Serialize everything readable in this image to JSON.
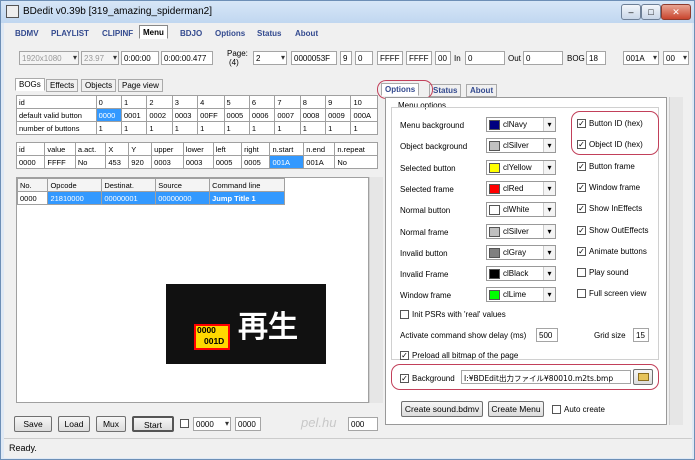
{
  "window": {
    "title": "BDedit v0.39b [319_amazing_spiderman2]",
    "min": "–",
    "max": "□",
    "close": "✕"
  },
  "tabs": [
    "BDMV",
    "PLAYLIST",
    "CLIPINF",
    "Menu",
    "BDJO",
    "Options",
    "Status",
    "About"
  ],
  "toolbar": {
    "resolution": "1920x1080",
    "framerate": "23.97",
    "time_start": "0:00:00",
    "time_end": "0:00:00.477",
    "page_label": "Page:",
    "page_count": "(4)",
    "page_value": "2",
    "page_field": "0000053F",
    "f1": "9",
    "f2": "0",
    "f3": "FFFF",
    "f4": "FFFF",
    "f5": "00",
    "in_label": "In",
    "in_value": "0",
    "out_label": "Out",
    "out_value": "0",
    "bog_label": "BOG",
    "bog_value": "18",
    "sel1": "001A",
    "sel2": "00"
  },
  "subtabs": [
    "BOGs",
    "Effects",
    "Objects",
    "Page view"
  ],
  "bog_table": {
    "header": [
      "id",
      "0",
      "1",
      "2",
      "3",
      "4",
      "5",
      "6",
      "7",
      "8",
      "9",
      "10"
    ],
    "rows": [
      [
        "default valid button",
        "0000",
        "0001",
        "0002",
        "0003",
        "00FF",
        "0005",
        "0006",
        "0007",
        "0008",
        "0009",
        "000A"
      ],
      [
        "number of buttons",
        "1",
        "1",
        "1",
        "1",
        "1",
        "1",
        "1",
        "1",
        "1",
        "1",
        "1"
      ]
    ]
  },
  "button_table": {
    "header": [
      "id",
      "value",
      "a.act.",
      "X",
      "Y",
      "upper",
      "lower",
      "left",
      "right",
      "n.start",
      "n.end",
      "n.repeat"
    ],
    "row": [
      "0000",
      "FFFF",
      "No",
      "453",
      "920",
      "0003",
      "0003",
      "0005",
      "0005",
      "001A",
      "001A",
      "No"
    ]
  },
  "cmd_table": {
    "header": [
      "No.",
      "Opcode",
      "Destinat.",
      "Source",
      "Command line"
    ],
    "row": [
      "0000",
      "21810000",
      "00000001",
      "00000000",
      "Jump Title 1"
    ]
  },
  "preview": {
    "label1": "0000",
    "label2": "001D",
    "text": "再生"
  },
  "options_panel": {
    "tabs": [
      "Options",
      "Status",
      "About"
    ],
    "group_title": "Menu options",
    "colors": [
      {
        "label": "Menu background",
        "value": "clNavy",
        "color": "#000080"
      },
      {
        "label": "Object background",
        "value": "clSilver",
        "color": "#c0c0c0"
      },
      {
        "label": "Selected button",
        "value": "clYellow",
        "color": "#ffff00"
      },
      {
        "label": "Selected frame",
        "value": "clRed",
        "color": "#ff0000"
      },
      {
        "label": "Normal button",
        "value": "clWhite",
        "color": "#ffffff"
      },
      {
        "label": "Normal frame",
        "value": "clSilver",
        "color": "#c0c0c0"
      },
      {
        "label": "Invalid button",
        "value": "clGray",
        "color": "#808080"
      },
      {
        "label": "Invalid Frame",
        "value": "clBlack",
        "color": "#000000"
      },
      {
        "label": "Window frame",
        "value": "clLime",
        "color": "#00ff00"
      }
    ],
    "checks": [
      {
        "label": "Button ID (hex)",
        "checked": true
      },
      {
        "label": "Object ID (hex)",
        "checked": true
      },
      {
        "label": "Button frame",
        "checked": true
      },
      {
        "label": "Window frame",
        "checked": true
      },
      {
        "label": "Show InEffects",
        "checked": true
      },
      {
        "label": "Show OutEffects",
        "checked": true
      },
      {
        "label": "Animate buttons",
        "checked": true
      },
      {
        "label": "Play sound",
        "checked": false
      },
      {
        "label": "Full screen view",
        "checked": false
      }
    ],
    "init_psrs": "Init PSRs with 'real' values",
    "delay_label": "Activate command show delay (ms)",
    "delay_value": "500",
    "grid_label": "Grid size",
    "grid_value": "15",
    "preload": "Preload all bitmap of the page",
    "background_label": "Background",
    "background_path": "I:¥BDEdit出力ファイル¥80010.m2ts.bmp",
    "create_sound": "Create sound.bdmv",
    "create_menu": "Create Menu",
    "auto_create": "Auto create"
  },
  "bottom": {
    "save": "Save",
    "load": "Load",
    "mux": "Mux",
    "start": "Start",
    "val1": "0000",
    "val2": "0000",
    "val3": "000",
    "watermark": "pel.hu"
  },
  "status_text": "Ready."
}
